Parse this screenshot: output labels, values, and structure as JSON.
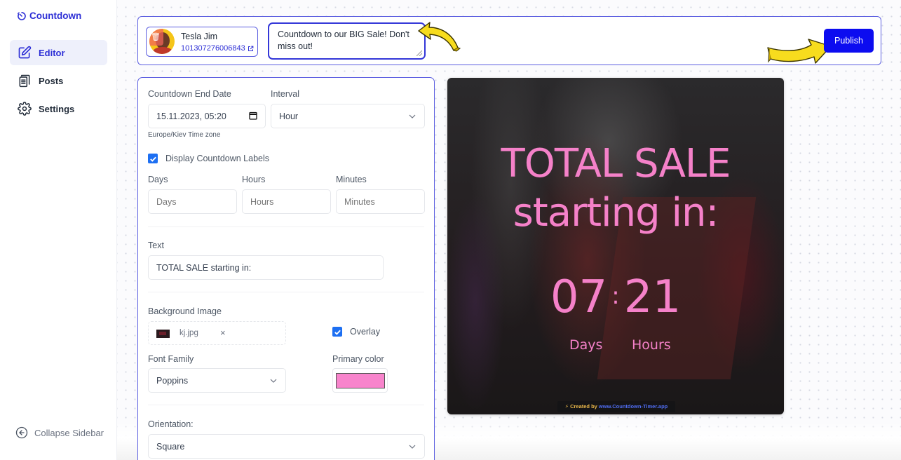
{
  "app": {
    "logo_text": "Countdown"
  },
  "sidebar": {
    "items": [
      {
        "label": "Editor",
        "icon": "edit-icon",
        "active": true
      },
      {
        "label": "Posts",
        "icon": "clipboard-icon",
        "active": false
      },
      {
        "label": "Settings",
        "icon": "gear-icon",
        "active": false
      }
    ],
    "collapse_label": "Collapse Sidebar"
  },
  "topbar": {
    "profile": {
      "name": "Tesla Jim",
      "id": "101307276006843"
    },
    "post_text": "Countdown to our BIG Sale! Don't miss out!",
    "publish_label": "Publish"
  },
  "form": {
    "end_date": {
      "label": "Countdown End Date",
      "value": "15.11.2023, 05:20",
      "timezone_note": "Europe/Kiev Time zone"
    },
    "interval": {
      "label": "Interval",
      "value": "Hour"
    },
    "display_labels": {
      "label": "Display Countdown Labels",
      "checked": true
    },
    "unit_labels": {
      "days": {
        "label": "Days",
        "placeholder": "Days"
      },
      "hours": {
        "label": "Hours",
        "placeholder": "Hours"
      },
      "minutes": {
        "label": "Minutes",
        "placeholder": "Minutes"
      }
    },
    "text": {
      "label": "Text",
      "value": "TOTAL SALE starting in:"
    },
    "background_image": {
      "label": "Background Image",
      "file_name": "kj.jpg",
      "remove_glyph": "×"
    },
    "overlay": {
      "label": "Overlay",
      "checked": true
    },
    "font_family": {
      "label": "Font Family",
      "value": "Poppins"
    },
    "primary_color": {
      "label": "Primary color",
      "value": "#f884cc"
    },
    "orientation": {
      "label": "Orientation:",
      "value": "Square"
    }
  },
  "preview": {
    "title": "TOTAL SALE starting in:",
    "timer": {
      "days": "07",
      "separator": ":",
      "hours": "21"
    },
    "labels": {
      "days": "Days",
      "hours": "Hours"
    },
    "credit_prefix": "⚡ Created by ",
    "credit_link": "www.Countdown-Timer.app"
  },
  "colors": {
    "accent": "#2d2fd6",
    "publish": "#0c0cf0",
    "preview_text": "#f581c9"
  }
}
